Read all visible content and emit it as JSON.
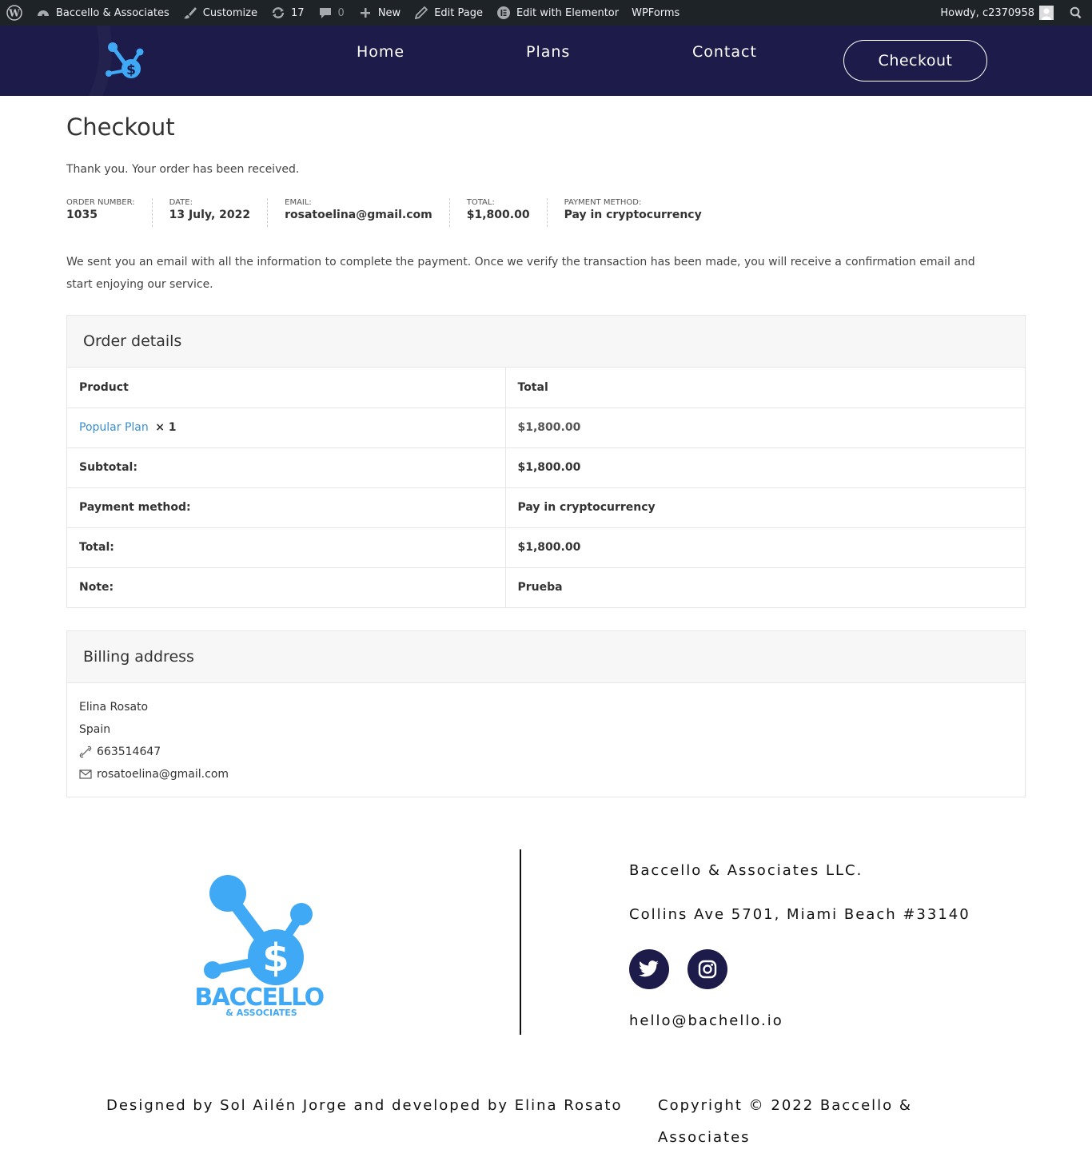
{
  "admin_bar": {
    "site_name": "Baccello & Associates",
    "customize": "Customize",
    "updates_count": "17",
    "comments_count": "0",
    "new_label": "New",
    "edit_page": "Edit Page",
    "edit_elementor": "Edit with Elementor",
    "wpforms": "WPForms",
    "howdy": "Howdy, c2370958"
  },
  "nav": {
    "home": "Home",
    "plans": "Plans",
    "contact": "Contact",
    "checkout_button": "Checkout"
  },
  "page": {
    "title": "Checkout",
    "thank_you": "Thank you. Your order has been received.",
    "info": "We sent you an email with all the information to complete the payment. Once we verify the transaction has been made, you will receive a confirmation email and start enjoying our service."
  },
  "order_overview": {
    "order_number_label": "Order number:",
    "order_number": "1035",
    "date_label": "Date:",
    "date": "13 July, 2022",
    "email_label": "Email:",
    "email": "rosatoelina@gmail.com",
    "total_label": "Total:",
    "total": "$1,800.00",
    "payment_label": "Payment method:",
    "payment": "Pay in cryptocurrency"
  },
  "order_details": {
    "heading": "Order details",
    "col_product": "Product",
    "col_total": "Total",
    "product_name": "Popular Plan",
    "product_qty": "× 1",
    "product_total": "$1,800.00",
    "rows": [
      {
        "label": "Subtotal:",
        "value": "$1,800.00"
      },
      {
        "label": "Payment method:",
        "value": "Pay in cryptocurrency"
      },
      {
        "label": "Total:",
        "value": "$1,800.00"
      },
      {
        "label": "Note:",
        "value": "Prueba"
      }
    ]
  },
  "billing": {
    "heading": "Billing address",
    "name": "Elina Rosato",
    "country": "Spain",
    "phone": "663514647",
    "email": "rosatoelina@gmail.com"
  },
  "footer": {
    "logo_text": "BACCELLO",
    "logo_subtext": "& ASSOCIATES",
    "company": "Baccello & Associates LLC.",
    "address": "Collins Ave 5701, Miami Beach #33140",
    "email": "hello@bachello.io",
    "credits": "Designed by Sol Ailén Jorge and developed by Elina Rosato",
    "copyright_line1": "Copyright © 2022 Baccello &",
    "copyright_line2": "Associates"
  },
  "colors": {
    "brand_navy": "#1c1b4a",
    "brand_blue": "#3fa9f5",
    "link_blue": "#3a8fd0",
    "admin_bar": "#1d2327"
  }
}
